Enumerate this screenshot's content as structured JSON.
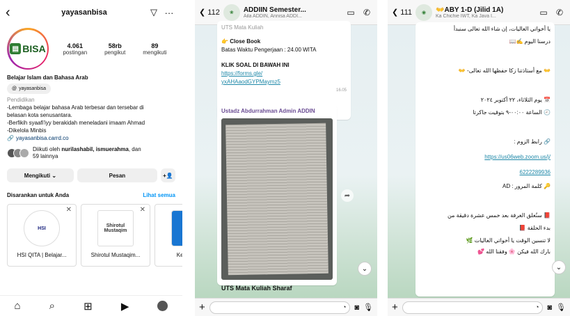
{
  "instagram": {
    "username": "yayasanbisa",
    "logo_text": "BISA",
    "posts_count": "4.061",
    "posts_label": "postingan",
    "followers_count": "58rb",
    "followers_label": "pengikut",
    "following_count": "89",
    "following_label": "mengikuti",
    "display_name": "Belajar Islam dan Bahasa Arab",
    "threads_handle": "yayasanbisa",
    "category": "Pendidikan",
    "bio_lines": [
      "-Lembaga belajar bahasa Arab terbesar dan tersebar di",
      "belasan kota senusantara.",
      "-Berfikih syaafi'iyy berakidah meneladani imaam Ahmad",
      "-Dikelola Minbis"
    ],
    "website": "yayasanbisa.carrd.co",
    "followed_by_prefix": "Diikuti oleh ",
    "followed_by_names": "nurilashabil, ismuerahma",
    "followed_by_suffix": ", dan",
    "followed_by_more": "59 lainnya",
    "following_button": "Mengikuti",
    "message_button": "Pesan",
    "suggested_title": "Disarankan untuk Anda",
    "see_all": "Lihat semua",
    "suggestions": [
      {
        "name": "HSI QITA | Belajar...",
        "logo": "HSI"
      },
      {
        "name": "Shirotul Mustaqim...",
        "logo": "Shirotul Mustaqim"
      },
      {
        "name": "Kelas Bah",
        "logo": "K"
      }
    ]
  },
  "chat1": {
    "back_count": "112",
    "title": "ADDIIN Semester...",
    "subtitle": "Aila ADDIN, Annisa ADDI...",
    "top_fragment": "UTS Mata Kuliah",
    "closebook_title": "Close Book",
    "deadline": "Batas Waktu Pengerjaan : 24.00 WITA",
    "click_text": "KLIK SOAL DI BAWAH INI",
    "form_link_1": "https://forms.gle/",
    "form_link_2": "yxAHAaodGYPMaymz5",
    "time": "16.05",
    "sender": "Ustadz Abdurrahman Admin ADDIN",
    "caption": "UTS Mata Kuliah Sharaf"
  },
  "chat2": {
    "back_count": "111",
    "title": "ABY 1-D (Jilid 1A)",
    "subtitle": "Ka Chichie IWT, Ka Java I...",
    "lines": [
      "يا أخواتي الغاليات، إن شاء الله تعالى سنبدأ",
      "درسنا اليوم ✍️📖",
      "👐 مع أستاذتنا زكا حفظها الله تعالى- 👐",
      "📅 يوم الثلاثاء، ٢٢ أكتوبر ٢٠٢٤",
      "🕘 الساعة ٠٠:٠٠-٩ بتوقيت جاكرتا",
      "🔗 رابط الزوم :",
      "https://us06web.zoom.us/j/",
      "6222289936",
      "🔑 كلمة المرور : AD",
      "📕 سنُغلق الغرفة بعد خمس عشرة دقيقة من",
      "بدء الحلقة 📕",
      "لا تنسين الوقت يا أخواتي الغاليات 🌿",
      "بارك الله فيكن 🌸 وفقنا الله 💕"
    ]
  }
}
